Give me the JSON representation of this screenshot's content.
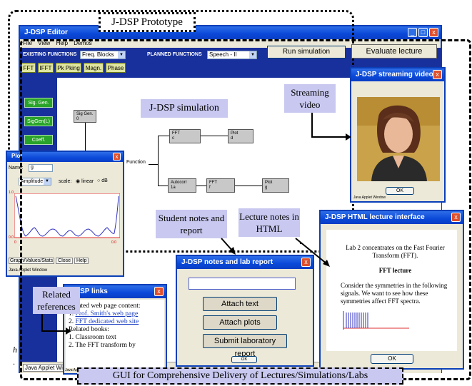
{
  "editor": {
    "title": "J-DSP Editor",
    "menu": [
      "File",
      "View",
      "Help",
      "Demos"
    ],
    "existing_label": "EXISTING FUNCTIONS",
    "existing_select": "Freq. Blocks",
    "planned_label": "PLANNED FUNCTIONS",
    "planned_select": "Speech - II",
    "run_button": "Run simulation",
    "func_buttons": [
      "FFT",
      "IFFT",
      "Pk Pking",
      "Magn.",
      "Phase"
    ],
    "side_buttons": [
      "Sig. Gen.",
      "SigGen(L)",
      "Coeff."
    ],
    "blocks": {
      "siggen": "Sig Gen.",
      "siggen_n": "0",
      "function": "Function",
      "fft1": "FFT",
      "fft1_n": "c",
      "plot1": "Plot",
      "plot1_n": "d",
      "autocorr": "Autocorr",
      "autocorr_n": "1a",
      "fft2": "FFT",
      "fft2_n": "f",
      "plot2": "Plot",
      "plot2_n": "g"
    },
    "taskbar": "Java Applet Window"
  },
  "plot_window": {
    "title": "Plot",
    "name_label": "Name:",
    "name_value": "g",
    "mode_select": "Amplitude",
    "scale_label": "scale:",
    "linear": "linear",
    "db": "dB",
    "ymax": "1.0",
    "ymin": "0.0",
    "xmin": "0",
    "xmax": "0.0",
    "buttons": [
      "Graph/Values/Stats",
      "Close",
      "Help"
    ],
    "status": "Java Applet Window"
  },
  "video_window": {
    "title": "J-DSP streaming video",
    "ok": "OK",
    "status": "Java Applet Window"
  },
  "evaluate_button": "Evaluate lecture",
  "html_window": {
    "title": "J-DSP HTML lecture interface",
    "intro": "Lab 2 concentrates on the Fast Fourier Transform (FFT).",
    "heading": "FFT lecture",
    "body": "Consider the symmetries in the following signals. We want to see how these symmetries affect FFT spectra.",
    "ok": "OK"
  },
  "notes_window": {
    "title": "J-DSP notes and lab report",
    "buttons": [
      "Attach text",
      "Attach plots",
      "Submit laboratory report"
    ],
    "ok": "OK"
  },
  "links_window": {
    "title": "J-DSP links",
    "related_web": "Related web page content:",
    "links": [
      "Prof. Smith's web page",
      "FFT dedicated web site"
    ],
    "related_books": "Related books:",
    "books": [
      "1. Classroom text",
      "2. The FFT transform by"
    ],
    "status": "Java Applet",
    "ok": "OK"
  },
  "callouts": {
    "prototype": "J-DSP Prototype",
    "simulation": "J-DSP simulation",
    "streaming": "Streaming video",
    "student_notes": "Student notes and report",
    "lecture_notes": "Lecture notes in HTML",
    "related_refs": "Related references",
    "gui": "GUI for Comprehensive Delivery of Lectures/Simulations/Labs"
  },
  "stray_text": [
    "h",
    "."
  ],
  "colors": {
    "xp_blue": "#0a48d8",
    "callout": "#c8c8f0",
    "green": "#29a329",
    "plot_red": "#e03030",
    "plot_blue": "#3030c0"
  }
}
